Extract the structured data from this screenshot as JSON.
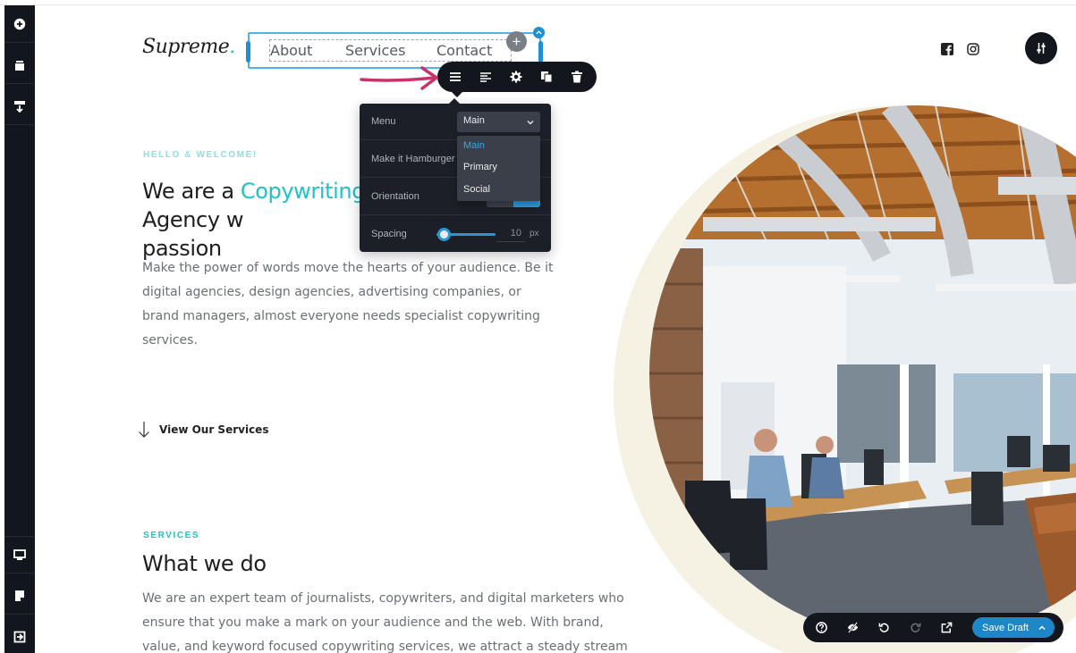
{
  "colors": {
    "accent_teal": "#1fc3c2",
    "editor_dark": "#13161d",
    "editor_blue": "#1e90d6",
    "arrow_pink": "#c8336b",
    "cream": "#f5f1e3"
  },
  "sidebar": {
    "items": [
      {
        "icon": "add-icon"
      },
      {
        "icon": "layers-icon"
      },
      {
        "icon": "sections-icon"
      },
      {
        "icon": "desktop-icon"
      },
      {
        "icon": "page-icon"
      },
      {
        "icon": "exit-icon"
      }
    ]
  },
  "header": {
    "logo_text": "Supreme",
    "logo_dot": ".",
    "nav": [
      "About",
      "Services",
      "Contact"
    ]
  },
  "toolbar": {
    "icons": [
      "menu-icon",
      "align-icon",
      "gear-icon",
      "duplicate-icon",
      "trash-icon"
    ]
  },
  "settings_panel": {
    "menu_label": "Menu",
    "menu_value": "Main",
    "menu_options": [
      "Main",
      "Primary",
      "Social"
    ],
    "hamburger_label": "Make it Hamburger",
    "orientation_label": "Orientation",
    "spacing_label": "Spacing",
    "spacing_value": "10",
    "spacing_unit": "px"
  },
  "hero": {
    "eyebrow": "HELLO & WELCOME!",
    "title_before": "We are a ",
    "title_highlight": "Copywriting",
    "title_after": " Agency w",
    "title_line2": "passion",
    "body_lines": [
      "Make the power of words move the hearts of your audience. Be it",
      "digital agencies, design agencies, advertising companies, or",
      "brand managers, almost everyone needs specialist copywriting",
      "services."
    ],
    "cta": "View Our Services"
  },
  "services": {
    "eyebrow": "SERVICES",
    "title": "What we do",
    "body_lines": [
      "We are an expert team of journalists, copywriters, and digital marketers who",
      "ensure that you make a mark on your audience and the web. With brand,",
      "value, and keyword focused copywriting services, we attract a steady stream"
    ]
  },
  "bottom_bar": {
    "icons": [
      "help-icon",
      "hide-icon",
      "undo-icon",
      "redo-icon",
      "preview-icon"
    ],
    "save_label": "Save Draft"
  }
}
